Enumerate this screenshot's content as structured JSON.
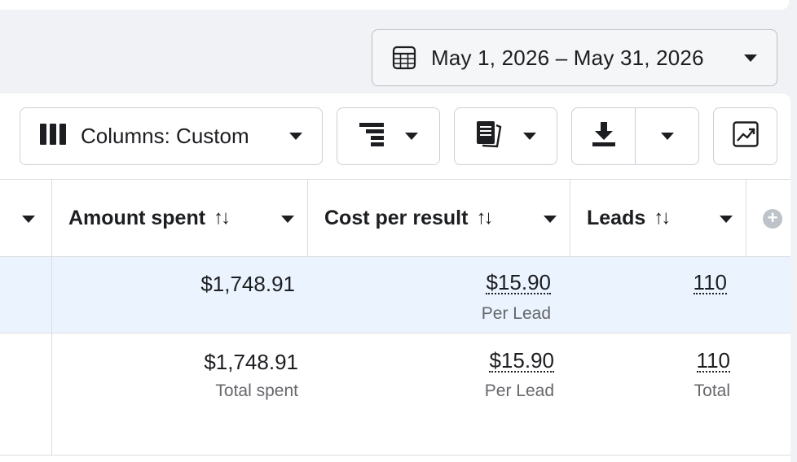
{
  "date_range": {
    "label": "May 1, 2026 – May 31, 2026",
    "icon": "calendar-icon"
  },
  "toolbar": {
    "columns_label": "Columns: Custom",
    "columns_icon": "columns-icon",
    "breakdown_icon": "breakdown-icon",
    "reports_icon": "reports-icon",
    "export_icon": "download-icon",
    "chart_icon": "chart-icon"
  },
  "table": {
    "headers": [
      {
        "label": "Amount spent",
        "sortable": true
      },
      {
        "label": "Cost per result",
        "sortable": true
      },
      {
        "label": "Leads",
        "sortable": true
      }
    ],
    "sort_glyph": "↑↓",
    "rows": [
      {
        "amount_spent": "$1,748.91",
        "cost_per_result": "$15.90",
        "cost_per_result_sub": "Per Lead",
        "leads": "110"
      },
      {
        "amount_spent": "$1,748.91",
        "amount_spent_sub": "Total spent",
        "cost_per_result": "$15.90",
        "cost_per_result_sub": "Per Lead",
        "leads": "110",
        "leads_sub": "Total"
      }
    ]
  },
  "colors": {
    "selected_row_bg": "#ebf3fe",
    "border": "#dadde1",
    "text": "#1c1e21",
    "subtext": "#65676b"
  }
}
